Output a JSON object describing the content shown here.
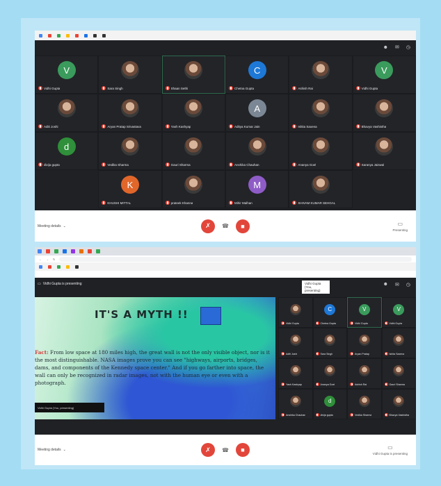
{
  "colors": {
    "background": "#a4ddf3",
    "meet_dark": "#202124",
    "end_call": "#e2463a",
    "mic_off": "#ea4335"
  },
  "shot1": {
    "grid": [
      {
        "name": "Vidhi Gupta",
        "initial": "V",
        "color": "#3a9b5c",
        "type": "letter"
      },
      {
        "name": "Sara Singh",
        "initial": "",
        "color": "",
        "type": "photo"
      },
      {
        "name": "Shaan Sethi",
        "initial": "",
        "color": "",
        "type": "photo",
        "active": true
      },
      {
        "name": "Chetna Gupta",
        "initial": "C",
        "color": "#1e78d6",
        "type": "letter"
      },
      {
        "name": "Ashish Rai",
        "initial": "",
        "color": "",
        "type": "photo"
      },
      {
        "name": "Vidhi Gupta",
        "initial": "V",
        "color": "#3a9b5c",
        "type": "letter"
      },
      {
        "name": "Aditi Joshi",
        "initial": "",
        "color": "",
        "type": "photo"
      },
      {
        "name": "Aryan Pratap Srivastava",
        "initial": "",
        "color": "",
        "type": "photo"
      },
      {
        "name": "Yash Kashyap",
        "initial": "",
        "color": "",
        "type": "photo"
      },
      {
        "name": "Aditya Kumar Jain",
        "initial": "A",
        "color": "#7b8794",
        "type": "letter"
      },
      {
        "name": "Ishita Saxena",
        "initial": "",
        "color": "",
        "type": "photo"
      },
      {
        "name": "Bhavya Vashistha",
        "initial": "",
        "color": "",
        "type": "photo"
      },
      {
        "name": "divija gupta",
        "initial": "d",
        "color": "#2f8f3a",
        "type": "letter"
      },
      {
        "name": "Vedika Sharma",
        "initial": "",
        "color": "",
        "type": "photo"
      },
      {
        "name": "Gauri Sharma",
        "initial": "",
        "color": "",
        "type": "photo"
      },
      {
        "name": "Anshika Chauhan",
        "initial": "",
        "color": "",
        "type": "photo"
      },
      {
        "name": "Ananya Goel",
        "initial": "",
        "color": "",
        "type": "photo"
      },
      {
        "name": "Saranya Jaiswal",
        "initial": "",
        "color": "",
        "type": "photo"
      },
      {
        "name": "",
        "type": "empty"
      },
      {
        "name": "KHUSHI MITTAL",
        "initial": "K",
        "color": "#e0662a",
        "type": "letter"
      },
      {
        "name": "prateek Khanna",
        "initial": "",
        "color": "",
        "type": "photo"
      },
      {
        "name": "Mihir Malhan",
        "initial": "M",
        "color": "#8e5cc7",
        "type": "letter"
      },
      {
        "name": "SHIVAM KUMAR SEHGAL",
        "initial": "",
        "color": "",
        "type": "photo"
      },
      {
        "name": "",
        "type": "empty"
      }
    ],
    "bottom_left": "Meeting details",
    "bottom_right": "Presenting"
  },
  "shot2": {
    "presenter_banner": "Vidhi Gupta is presenting",
    "pres_pill": "Vidhi Gupta (You, presenting)",
    "slide": {
      "title": "IT'S A MYTH !!",
      "label": "Fact:",
      "body": "From low space at 180 miles high, the great wall is not the only visible object, nor is it the most distinguishable. NASA images prove you can see \"highways, airports, bridges, dams, and components of the Kennedy space center.\" And if you go farther into space, the wall can only be recognized in radar images, not with the human eye or even with a photograph.",
      "caption": "Vidhi Gupta (You, presenting)"
    },
    "grid": [
      {
        "name": "Vidhi Gupta",
        "initial": "",
        "color": "",
        "type": "photo"
      },
      {
        "name": "Chetna Gupta",
        "initial": "C",
        "color": "#1e78d6",
        "type": "letter"
      },
      {
        "name": "Vidhi Gupta",
        "initial": "V",
        "color": "#3a9b5c",
        "type": "letter",
        "active": true
      },
      {
        "name": "Vidhi Gupta",
        "initial": "V",
        "color": "#3a9b5c",
        "type": "letter"
      },
      {
        "name": "Aditi Joshi",
        "initial": "",
        "color": "",
        "type": "photo"
      },
      {
        "name": "Sara Singh",
        "initial": "",
        "color": "",
        "type": "photo"
      },
      {
        "name": "Aryan Pratap",
        "initial": "",
        "color": "",
        "type": "photo"
      },
      {
        "name": "Ishita Saxena",
        "initial": "",
        "color": "",
        "type": "photo"
      },
      {
        "name": "Yash Kashyap",
        "initial": "",
        "color": "",
        "type": "photo"
      },
      {
        "name": "Ananya Goel",
        "initial": "",
        "color": "",
        "type": "photo"
      },
      {
        "name": "Ashish Rai",
        "initial": "",
        "color": "",
        "type": "photo"
      },
      {
        "name": "Gauri Sharma",
        "initial": "",
        "color": "",
        "type": "photo"
      },
      {
        "name": "Anshika Chauhan",
        "initial": "",
        "color": "",
        "type": "photo"
      },
      {
        "name": "divija gupta",
        "initial": "d",
        "color": "#2f8f3a",
        "type": "letter"
      },
      {
        "name": "Vedika Sharma",
        "initial": "",
        "color": "",
        "type": "photo"
      },
      {
        "name": "Bhavya Vashistha",
        "initial": "",
        "color": "",
        "type": "photo"
      }
    ],
    "bottom_left": "Meeting details",
    "bottom_right": "Vidhi Gupta is presenting"
  }
}
